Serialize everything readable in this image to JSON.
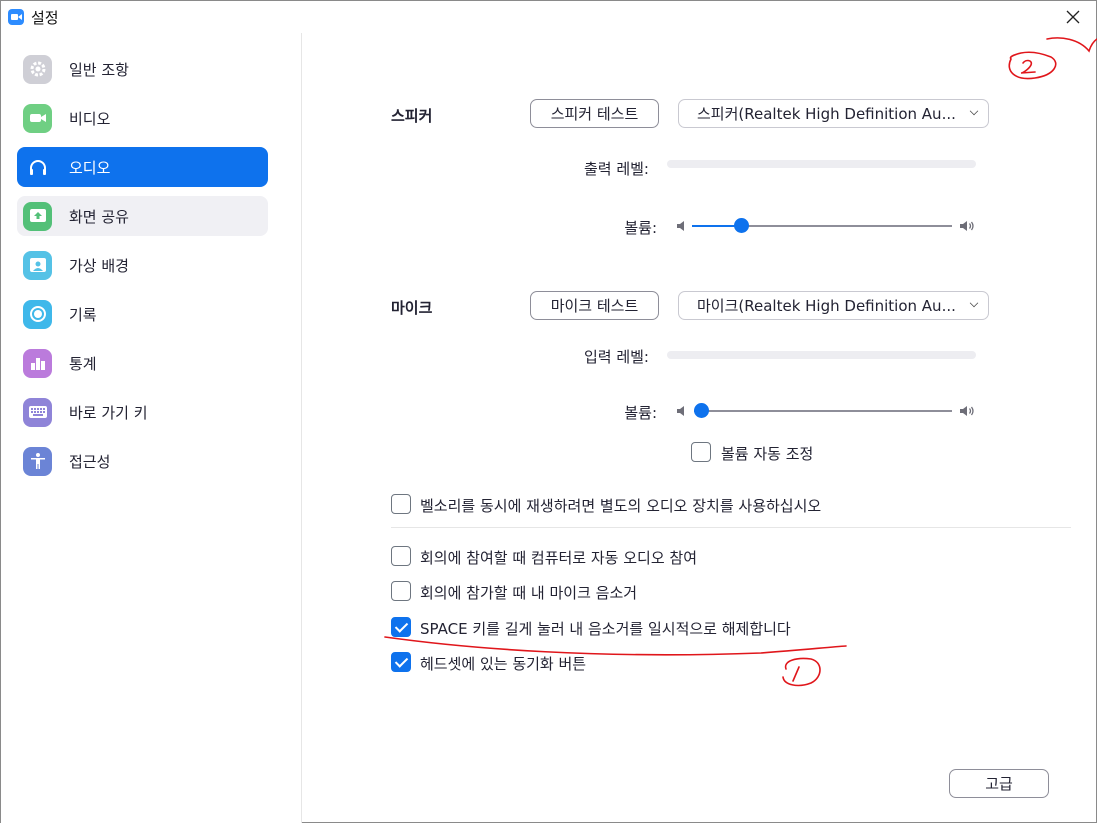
{
  "window": {
    "title": "설정",
    "close_glyph": "✕"
  },
  "sidebar": {
    "items": [
      {
        "label": "일반 조항",
        "icon": "gear-icon",
        "color": "#cfcfd6"
      },
      {
        "label": "비디오",
        "icon": "video-camera-icon",
        "color": "#6fcf83"
      },
      {
        "label": "오디오",
        "icon": "headphones-icon",
        "color": "#0e72ed"
      },
      {
        "label": "화면 공유",
        "icon": "share-screen-icon",
        "color": "#53c078"
      },
      {
        "label": "가상 배경",
        "icon": "background-person-icon",
        "color": "#55c2e6"
      },
      {
        "label": "기록",
        "icon": "record-icon",
        "color": "#3fb8ea"
      },
      {
        "label": "통계",
        "icon": "bar-chart-icon",
        "color": "#bb7bdc"
      },
      {
        "label": "바로 가기 키",
        "icon": "keyboard-icon",
        "color": "#8f84d8"
      },
      {
        "label": "접근성",
        "icon": "accessibility-icon",
        "color": "#6b84d6"
      }
    ],
    "active_index": 2
  },
  "speaker": {
    "label": "스피커",
    "test_button": "스피커 테스트",
    "device": "스피커(Realtek High Definition Au...",
    "output_level_label": "출력 레벨:",
    "volume_label": "볼륨:",
    "volume_fraction": 0.17
  },
  "mic": {
    "label": "마이크",
    "test_button": "마이크 테스트",
    "device": "마이크(Realtek High Definition Au...",
    "input_level_label": "입력 레벨:",
    "volume_label": "볼륨:",
    "volume_fraction": 0.0,
    "auto_adjust_label": "볼륨 자동 조정",
    "auto_adjust_checked": false
  },
  "options": [
    {
      "label": "벨소리를 동시에 재생하려면 별도의 오디오 장치를 사용하십시오",
      "checked": false
    },
    {
      "label": "회의에 참여할 때 컴퓨터로 자동 오디오 참여",
      "checked": false
    },
    {
      "label": "회의에 참가할 때 내 마이크 음소거",
      "checked": false
    },
    {
      "label": "SPACE 키를 길게 눌러 내 음소거를 일시적으로 해제합니다",
      "checked": true
    },
    {
      "label": "헤드셋에 있는 동기화 버튼",
      "checked": true
    }
  ],
  "advanced_button": "고급",
  "colors": {
    "accent": "#0e72ed",
    "annotation": "#e0161b"
  }
}
